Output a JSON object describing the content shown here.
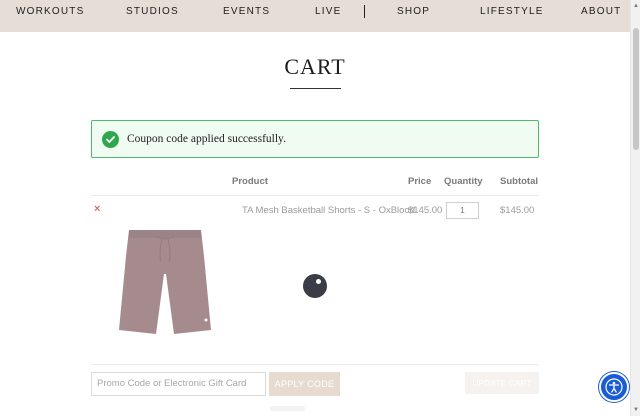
{
  "nav": {
    "items": [
      "WORKOUTS",
      "STUDIOS",
      "EVENTS",
      "LIVE",
      "SHOP",
      "LIFESTYLE",
      "ABOUT"
    ]
  },
  "page": {
    "title": "CART"
  },
  "notice": {
    "text": "Coupon code applied successfully.",
    "icon": "check-circle-icon",
    "color": "#2fa74f"
  },
  "table": {
    "headers": {
      "product": "Product",
      "price": "Price",
      "quantity": "Quantity",
      "subtotal": "Subtotal"
    },
    "rows": [
      {
        "remove": "×",
        "name": "TA Mesh Basketball Shorts - S - OxBlood",
        "price": "$145.00",
        "quantity": "1",
        "subtotal": "$145.00"
      }
    ]
  },
  "coupon": {
    "placeholder": "Promo Code or Electronic Gift Card",
    "apply_label": "APPLY CODE",
    "update_label": "UPDATE CART"
  },
  "colors": {
    "nav_bg": "#e6ddd6",
    "accent": "#e7dbd0",
    "success": "#4fb96a",
    "a11y": "#1a5bd6"
  }
}
